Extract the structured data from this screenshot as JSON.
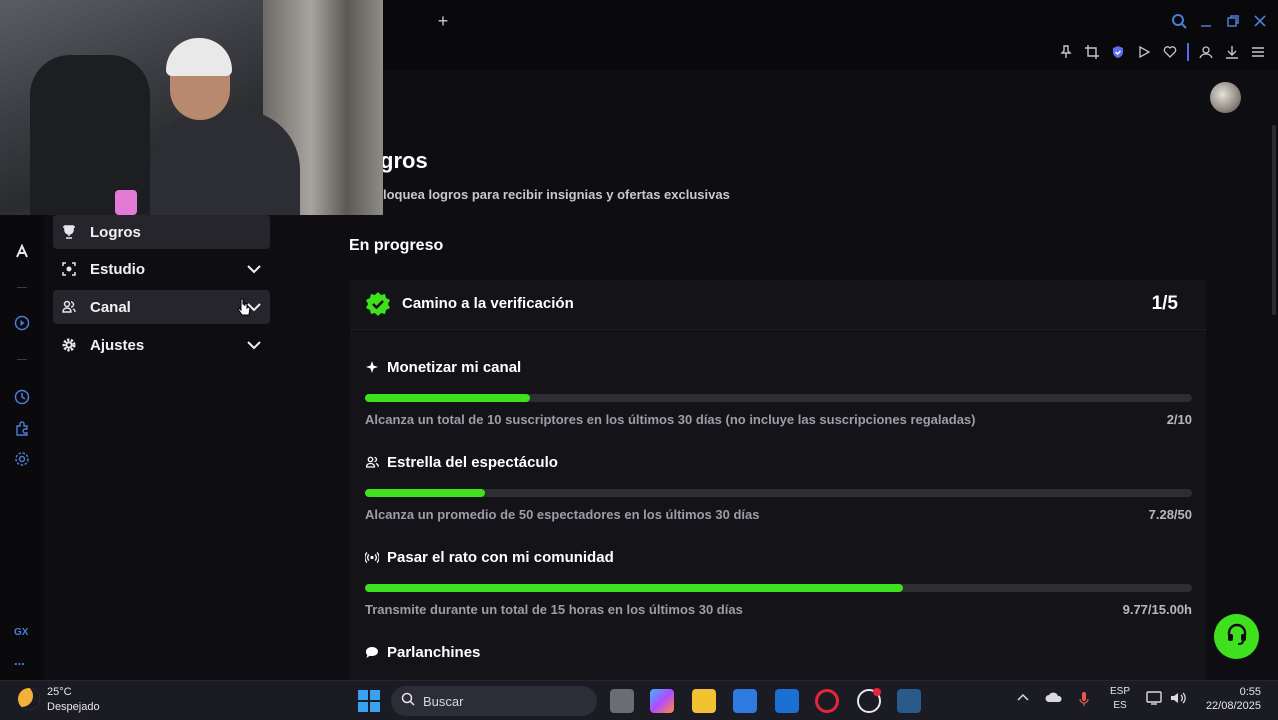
{
  "browser": {
    "new_tab_symbol": "+"
  },
  "sidebar": {
    "items": [
      {
        "label": "Logros",
        "icon": "trophy-icon",
        "selected": true,
        "expandable": false
      },
      {
        "label": "Estudio",
        "icon": "studio-icon",
        "selected": false,
        "expandable": true
      },
      {
        "label": "Canal",
        "icon": "channel-users-icon",
        "selected": false,
        "expandable": true
      },
      {
        "label": "Ajustes",
        "icon": "gear-icon",
        "selected": false,
        "expandable": true
      }
    ]
  },
  "rail": {
    "gx_label": "GX",
    "more_label": "..."
  },
  "page": {
    "title": "gros",
    "subtitle": "loquea logros para recibir insignias y ofertas exclusivas",
    "section_title": "En progreso"
  },
  "card": {
    "title": "Camino a la verificación",
    "progress": "1/5",
    "tasks": [
      {
        "title": "Monetizar mi canal",
        "icon": "sparkle-icon",
        "description": "Alcanza un total de 10 suscriptores en los últimos 30 días (no incluye las suscripciones regaladas)",
        "value": "2/10",
        "fraction": 0.2
      },
      {
        "title": "Estrella del espectáculo",
        "icon": "users-icon",
        "description": "Alcanza un promedio de 50 espectadores en los últimos 30 días",
        "value": "7.28/50",
        "fraction": 0.1456
      },
      {
        "title": "Pasar el rato con mi comunidad",
        "icon": "broadcast-icon",
        "description": "Transmite durante un total de 15 horas en los últimos 30 días",
        "value": "9.77/15.00h",
        "fraction": 0.651
      },
      {
        "title": "Parlanchines",
        "icon": "chat-bubble-icon"
      }
    ]
  },
  "colors": {
    "accent": "#3fe01d",
    "background": "#0e0e12",
    "card": "#131318"
  },
  "taskbar": {
    "weather_temp": "25°C",
    "weather_desc": "Despejado",
    "search_placeholder": "Buscar",
    "lang_top": "ESP",
    "lang_bottom": "ES",
    "time": "0:55",
    "date": "22/08/2025"
  }
}
